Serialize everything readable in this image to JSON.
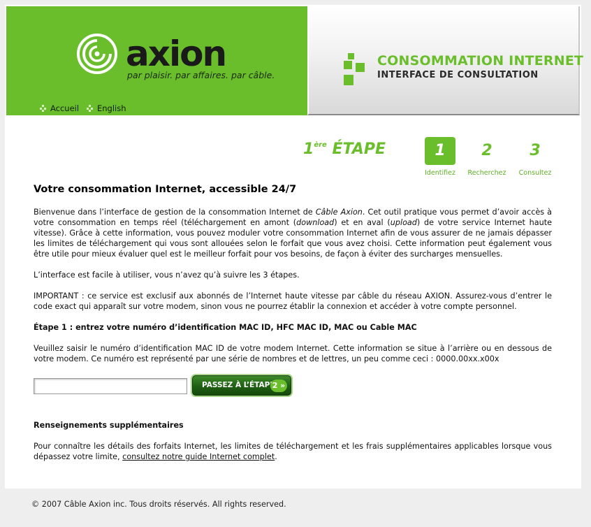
{
  "header": {
    "logo_word": "axion",
    "logo_tagline": "par plaisir. par affaires. par câble.",
    "nav": [
      {
        "label": "Accueil"
      },
      {
        "label": "English"
      }
    ],
    "title_main": "CONSOMMATION INTERNET",
    "title_sub": "INTERFACE DE CONSULTATION"
  },
  "steps": {
    "heading_number": "1",
    "heading_sup": "ère",
    "heading_word": "ÉTAPE",
    "items": [
      {
        "number": "1",
        "label": "Identifiez",
        "active": true
      },
      {
        "number": "2",
        "label": "Recherchez",
        "active": false
      },
      {
        "number": "3",
        "label": "Consultez",
        "active": false
      }
    ]
  },
  "content": {
    "heading": "Votre consommation Internet, accessible 24/7",
    "intro_parts": [
      "Bienvenue dans l’interface de gestion de la consommation Internet de ",
      "Câble Axion",
      ". Cet outil pratique vous permet d’avoir accès à votre consommation en temps réel (téléchargement en amont (",
      "download",
      ") et en aval (",
      "upload",
      ") de votre service Internet haute vitesse). Grâce à cette information, vous pouvez moduler votre consommation Internet afin de vous assurer de ne jamais dépasser les limites de téléchargement qui vous sont allouées selon le forfait que vous avez choisi. Cette information peut également vous être utile pour mieux évaluer quel est le meilleur forfait pour vos besoins, de façon à éviter des surcharges mensuelles."
    ],
    "easy": "L’interface est facile à utiliser, vous n’avez qu’à suivre les 3 étapes.",
    "important": "IMPORTANT : ce service est exclusif aux abonnés de l’Internet haute vitesse par câble du réseau AXION. Assurez-vous d’entrer le code exact qui apparaît sur votre modem, sinon vous ne pourrez établir la connexion et accéder à votre compte personnel.",
    "step1_heading": "Étape 1 : entrez votre numéro d’identification MAC ID, HFC MAC ID, MAC ou Cable MAC",
    "step1_text": "Veuillez saisir le numéro d’identification MAC ID de votre modem Internet. Cette information se situe à l’arrière ou en dessous de votre modem. Ce numéro est représenté par une série de nombres et de lettres, un peu comme ceci : 0000.00xx.x00x",
    "mac_input_value": "",
    "next_button_label": "PASSEZ À L’ÉTAPE",
    "next_button_badge": "2 »",
    "more_heading": "Renseignements supplémentaires",
    "more_text": "Pour connaître les détails des forfaits Internet, les limites de téléchargement et les frais supplémentaires applicables lorsque vous dépassez votre limite, ",
    "more_link": "consultez notre guide Internet complet",
    "more_end": "."
  },
  "footer": "© 2007 Câble Axion inc. Tous droits réservés. All rights reserved.",
  "colors": {
    "brand_green": "#6abe2c",
    "button_dark_green": "#1f5e14"
  }
}
